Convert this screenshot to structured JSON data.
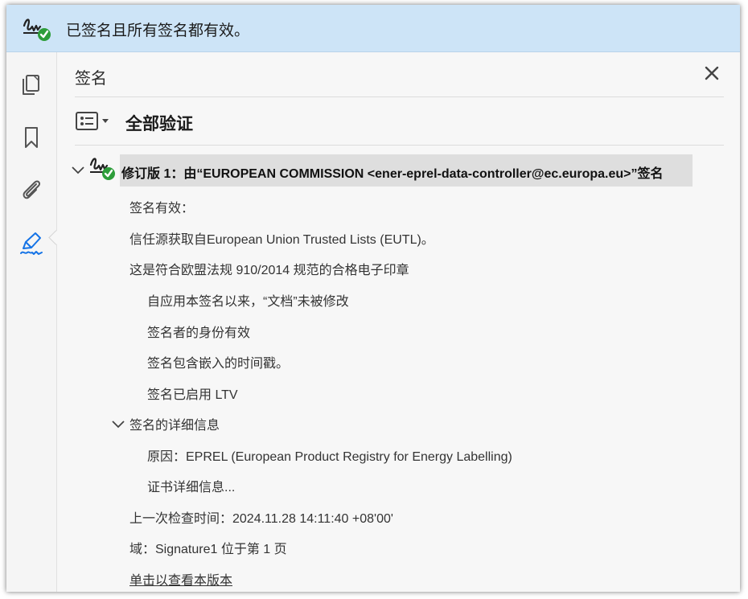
{
  "banner": {
    "icon": "signature-valid-icon",
    "text": "已签名且所有签名都有效。"
  },
  "sidebar": {
    "items": [
      {
        "icon": "pages-icon"
      },
      {
        "icon": "bookmark-icon"
      },
      {
        "icon": "attachment-icon"
      },
      {
        "icon": "signature-pen-icon",
        "active": true
      }
    ]
  },
  "panel": {
    "title": "签名",
    "options_icon": "options-list-icon",
    "verify_all": "全部验证"
  },
  "revision": {
    "label": "修订版 1：由“EUROPEAN COMMISSION <ener-eprel-data-controller@ec.europa.eu>”签名",
    "details": [
      "签名有效：",
      "信任源获取自European Union Trusted Lists (EUTL)。",
      "这是符合欧盟法规 910/2014 规范的合格电子印章"
    ],
    "checks": [
      "自应用本签名以来，“文档”未被修改",
      "签名者的身份有效",
      "签名包含嵌入的时间戳。",
      "签名已启用 LTV"
    ],
    "signature_details": {
      "label": "签名的详细信息",
      "reason": "原因：EPREL (European Product Registry for Energy Labelling)",
      "certificate_link": "证书详细信息..."
    },
    "last_checked": "上一次检查时间：2024.11.28 14:11:40 +08'00'",
    "field": "域：Signature1 位于第 1 页",
    "view_version_link": "单击以查看本版本"
  },
  "colors": {
    "banner_bg": "#cde4f7",
    "valid_green": "#2d9d3a",
    "active_icon_blue": "#1473e6"
  }
}
